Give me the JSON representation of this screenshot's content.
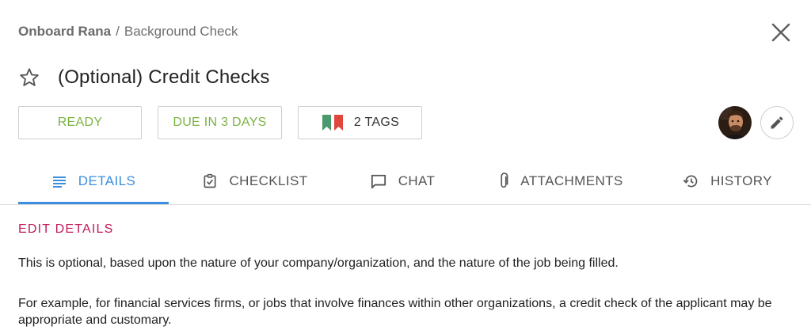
{
  "breadcrumb": {
    "parent": "Onboard Rana",
    "separator": "/",
    "current": "Background Check"
  },
  "task": {
    "title": "(Optional) Credit Checks"
  },
  "chips": {
    "status": "READY",
    "due": "DUE IN 3 DAYS",
    "tags": "2 TAGS",
    "status_color": "#7cb342",
    "tag_colors": [
      "#4a9a6e",
      "#e0463a"
    ]
  },
  "tabs": [
    {
      "label": "DETAILS",
      "icon": "details-list-icon",
      "active": true
    },
    {
      "label": "CHECKLIST",
      "icon": "checklist-icon",
      "active": false
    },
    {
      "label": "CHAT",
      "icon": "chat-bubble-icon",
      "active": false
    },
    {
      "label": "ATTACHMENTS",
      "icon": "paperclip-icon",
      "active": false
    },
    {
      "label": "HISTORY",
      "icon": "history-icon",
      "active": false
    }
  ],
  "accent_color": "#3b8ede",
  "details": {
    "heading": "EDIT DETAILS",
    "heading_color": "#c2185b",
    "paragraphs": [
      "This is optional, based upon the nature of your company/organization, and the nature of the job being filled.",
      "For example, for financial services firms, or jobs that involve finances within other organizations, a credit check of the applicant may be appropriate and customary."
    ]
  }
}
